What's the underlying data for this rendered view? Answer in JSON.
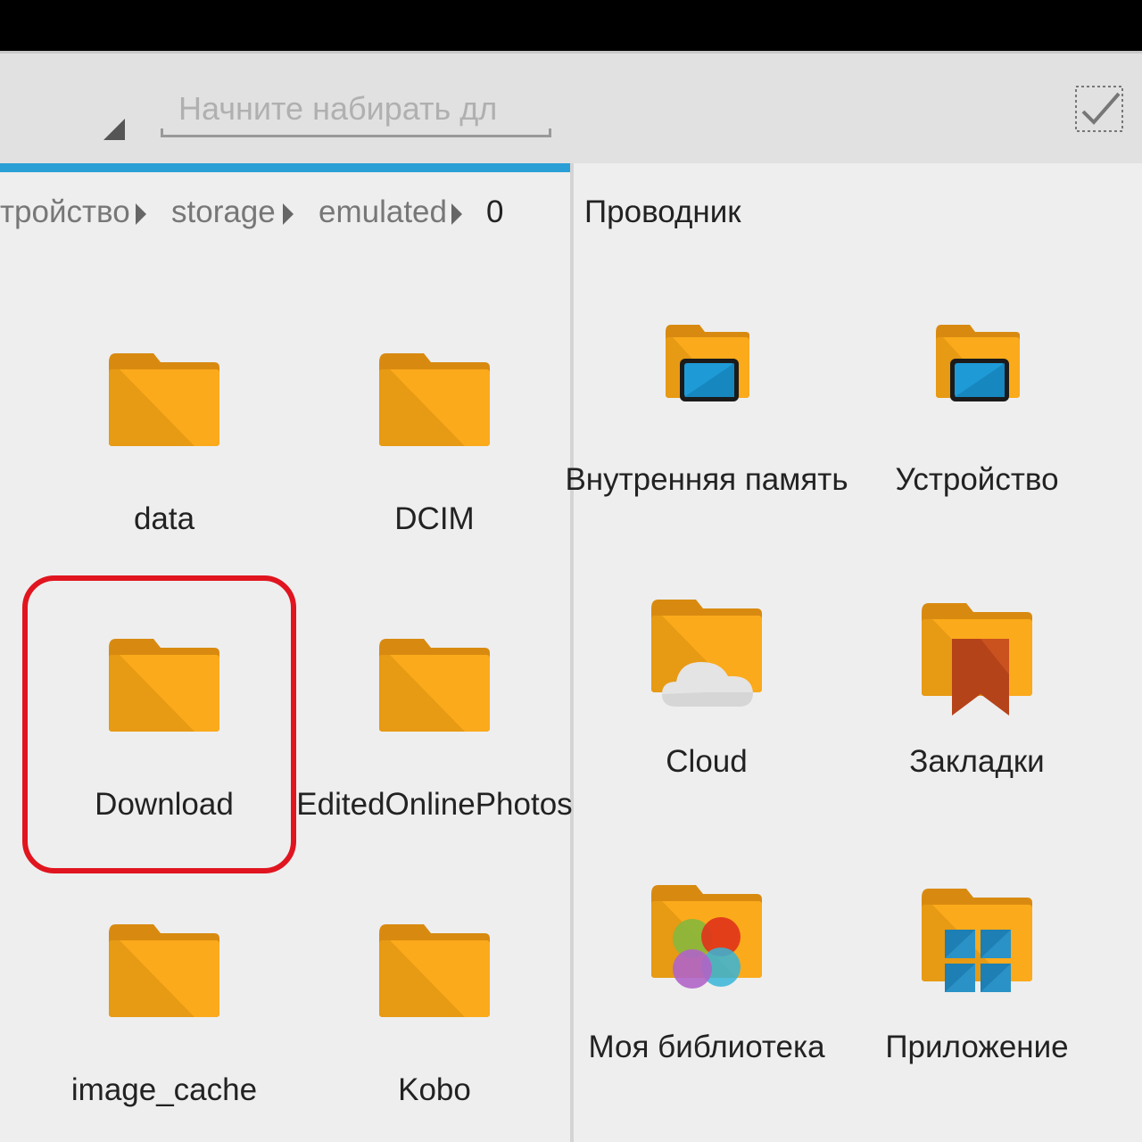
{
  "search": {
    "placeholder": "Начните набирать дл"
  },
  "breadcrumb": {
    "items": [
      "тройство",
      "storage",
      "emulated",
      "0"
    ]
  },
  "left_pane": {
    "folders": [
      {
        "name": "data"
      },
      {
        "name": "DCIM"
      },
      {
        "name": "Download",
        "highlighted": true
      },
      {
        "name": "EditedOnlinePhotos"
      },
      {
        "name": "image_cache"
      },
      {
        "name": "Kobo"
      }
    ]
  },
  "right_pane": {
    "title": "Проводник",
    "items": [
      {
        "label": "Внутренняя память",
        "icon": "internal-storage-icon"
      },
      {
        "label": "Устройство",
        "icon": "device-icon"
      },
      {
        "label": "Cloud",
        "icon": "cloud-folder-icon"
      },
      {
        "label": "Закладки",
        "icon": "bookmarks-folder-icon"
      },
      {
        "label": "Моя библиотека",
        "icon": "library-folder-icon"
      },
      {
        "label": "Приложение",
        "icon": "apps-folder-icon"
      }
    ]
  },
  "colors": {
    "folder_back": "#d88a10",
    "folder_front": "#fbaa1b",
    "folder_shade": "#e79a14",
    "accent_blue": "#2a9fd6",
    "highlight_red": "#e0151f"
  }
}
